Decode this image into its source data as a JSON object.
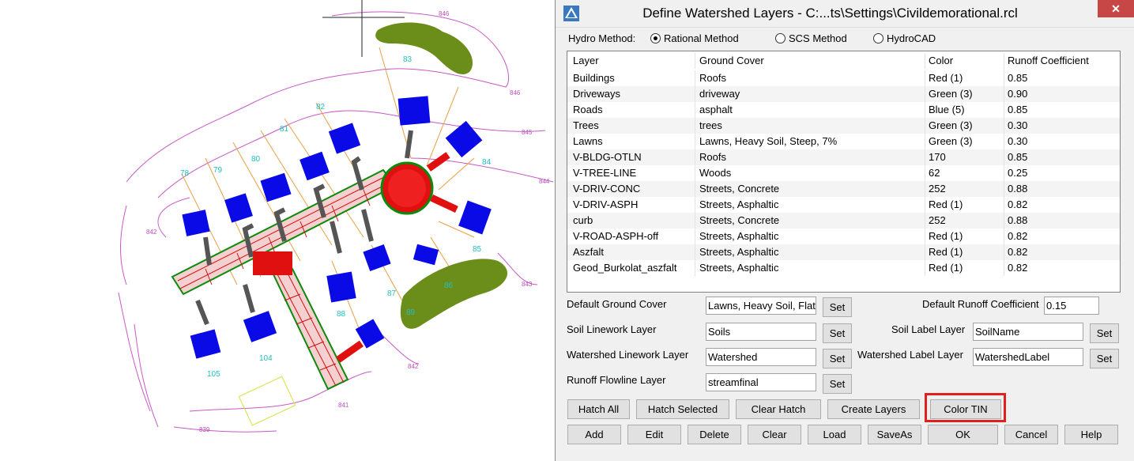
{
  "cad": {
    "lot_labels": [
      "78",
      "79",
      "80",
      "81",
      "82",
      "83",
      "84",
      "85",
      "86",
      "87",
      "88",
      "89",
      "104",
      "105"
    ],
    "contour_labels": [
      "846",
      "846",
      "845",
      "844",
      "843",
      "842",
      "841",
      "839",
      "842"
    ]
  },
  "dialog": {
    "title": "Define Watershed Layers - C:...ts\\Settings\\Civildemorational.rcl",
    "close_label": "✕",
    "hydro_method_label": "Hydro Method:",
    "methods": [
      {
        "label": "Rational Method",
        "selected": true
      },
      {
        "label": "SCS Method",
        "selected": false
      },
      {
        "label": "HydroCAD",
        "selected": false
      }
    ],
    "columns": [
      "Layer",
      "Ground Cover",
      "Color",
      "Runoff Coefficient"
    ],
    "rows": [
      {
        "layer": "Buildings",
        "cover": "Roofs",
        "color": "Red (1)",
        "coef": "0.85"
      },
      {
        "layer": "Driveways",
        "cover": "driveway",
        "color": "Green (3)",
        "coef": "0.90"
      },
      {
        "layer": "Roads",
        "cover": "asphalt",
        "color": "Blue (5)",
        "coef": "0.85"
      },
      {
        "layer": "Trees",
        "cover": "trees",
        "color": "Green (3)",
        "coef": "0.30"
      },
      {
        "layer": "Lawns",
        "cover": "Lawns, Heavy Soil, Steep, 7%",
        "color": "Green (3)",
        "coef": "0.30"
      },
      {
        "layer": "V-BLDG-OTLN",
        "cover": "Roofs",
        "color": "170",
        "coef": "0.85"
      },
      {
        "layer": "V-TREE-LINE",
        "cover": "Woods",
        "color": "62",
        "coef": "0.25"
      },
      {
        "layer": "V-DRIV-CONC",
        "cover": "Streets, Concrete",
        "color": "252",
        "coef": "0.88"
      },
      {
        "layer": "V-DRIV-ASPH",
        "cover": "Streets, Asphaltic",
        "color": "Red (1)",
        "coef": "0.82"
      },
      {
        "layer": "curb",
        "cover": "Streets, Concrete",
        "color": "252",
        "coef": "0.88"
      },
      {
        "layer": "V-ROAD-ASPH-off",
        "cover": "Streets, Asphaltic",
        "color": "Red (1)",
        "coef": "0.82"
      },
      {
        "layer": "Aszfalt",
        "cover": "Streets, Asphaltic",
        "color": "Red (1)",
        "coef": "0.82"
      },
      {
        "layer": "Geod_Burkolat_aszfalt",
        "cover": "Streets, Asphaltic",
        "color": "Red (1)",
        "coef": "0.82"
      }
    ],
    "default_ground_cover_label": "Default Ground Cover",
    "default_ground_cover_value": "Lawns, Heavy Soil, Flat",
    "default_runoff_label": "Default Runoff Coefficient",
    "default_runoff_value": "0.15",
    "soil_linework_label": "Soil Linework Layer",
    "soil_linework_value": "Soils",
    "soil_label_layer_label": "Soil Label Layer",
    "soil_label_layer_value": "SoilName",
    "watershed_linework_label": "Watershed Linework Layer",
    "watershed_linework_value": "Watershed",
    "watershed_label_layer_label": "Watershed Label Layer",
    "watershed_label_layer_value": "WatershedLabel",
    "runoff_flowline_label": "Runoff Flowline Layer",
    "runoff_flowline_value": "streamfinal",
    "set_label": "Set",
    "buttons_row1": [
      "Hatch All",
      "Hatch Selected",
      "Clear Hatch",
      "Create Layers",
      "Color TIN"
    ],
    "buttons_row2": [
      "Add",
      "Edit",
      "Delete",
      "Clear",
      "Load",
      "SaveAs",
      "OK",
      "Cancel",
      "Help"
    ]
  },
  "colors": {
    "highlight": "#e0201e",
    "building": "#0a0ae6",
    "road_tin": "#e01010",
    "tree": "#6b8e1a",
    "contour": "#c050c0",
    "lot_line": "#e8a040",
    "lot_label": "#20c0c0"
  }
}
